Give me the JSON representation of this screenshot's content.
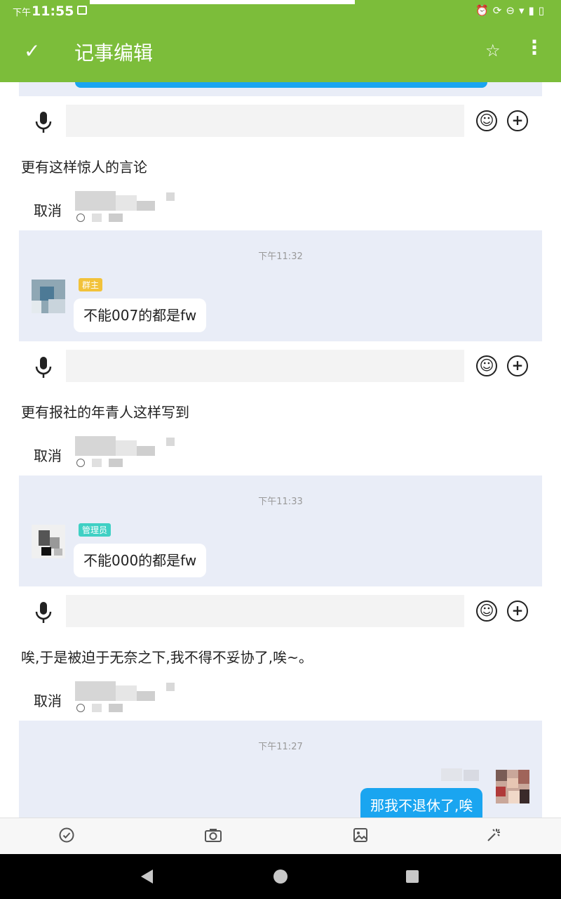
{
  "status_bar": {
    "ampm": "下午",
    "time": "11:55"
  },
  "app_bar": {
    "title": "记事编辑"
  },
  "entries": [
    {
      "text": "更有这样惊人的言论",
      "cancel_label": "取消"
    },
    {
      "text": "更有报社的年青人这样写到",
      "cancel_label": "取消"
    },
    {
      "text": "唉,于是被迫于无奈之下,我不得不妥协了,唉~。",
      "cancel_label": "取消"
    }
  ],
  "chats": [
    {
      "timestamp": "下午11:32",
      "role": "群主",
      "role_color": "#f2c23a",
      "message": "不能007的都是fw"
    },
    {
      "timestamp": "下午11:33",
      "role": "管理员",
      "role_color": "#3fd0c4",
      "message": "不能000的都是fw"
    },
    {
      "timestamp": "下午11:27",
      "message": "那我不退休了,唉"
    }
  ],
  "colors": {
    "app_bar": "#7cbd3a",
    "chat_bg": "#e9edf7",
    "bubble_blue": "#1aa5f0"
  }
}
